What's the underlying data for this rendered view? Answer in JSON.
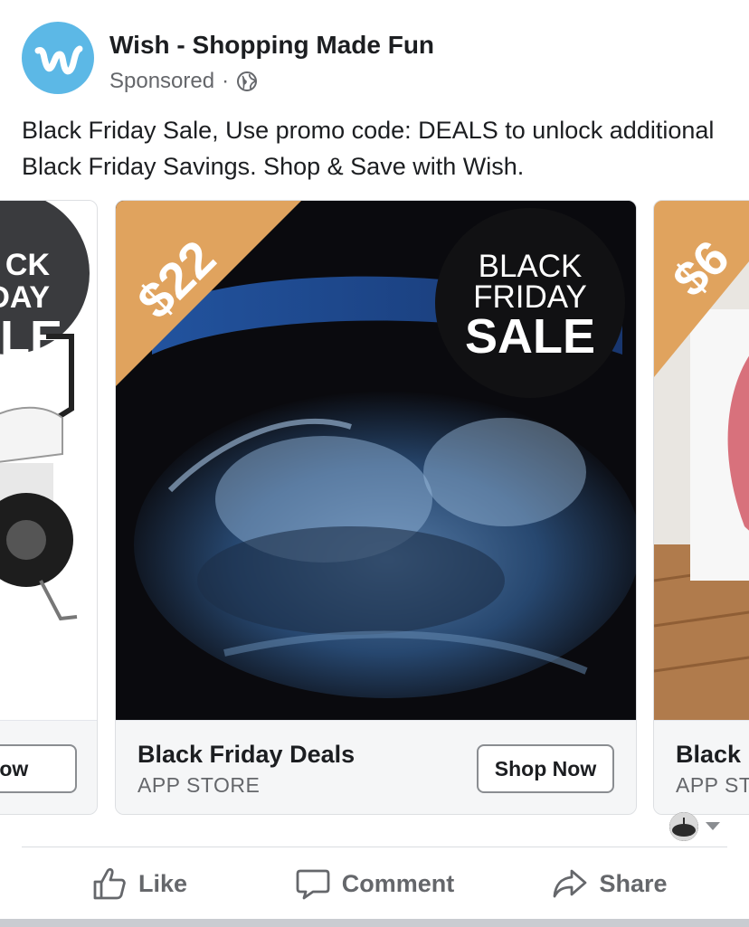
{
  "post": {
    "page_name": "Wish - Shopping Made Fun",
    "sponsored": "Sponsored",
    "separator": "·",
    "audience_icon": "globe-icon",
    "logo_letter": "w",
    "text": "Black Friday Sale, Use promo code: DEALS to unlock additional Black Friday Savings. Shop & Save with Wish."
  },
  "carousel": {
    "cards": [
      {
        "badge_lines": [
          "CK",
          "DAY",
          "LE"
        ],
        "button": "Now"
      },
      {
        "price": "$22",
        "badge_lines": [
          "BLACK",
          "FRIDAY",
          "SALE"
        ],
        "title": "Black Friday Deals",
        "subtitle": "APP STORE",
        "button": "Shop Now"
      },
      {
        "price": "$6",
        "title": "Black",
        "subtitle": "APP ST"
      }
    ]
  },
  "actions": {
    "like": "Like",
    "comment": "Comment",
    "share": "Share"
  },
  "colors": {
    "brand": "#5cb8e6",
    "price_banner": "#e0a35e",
    "ultrasound_bg": "#0a0a0e",
    "text_secondary": "#65676b"
  }
}
